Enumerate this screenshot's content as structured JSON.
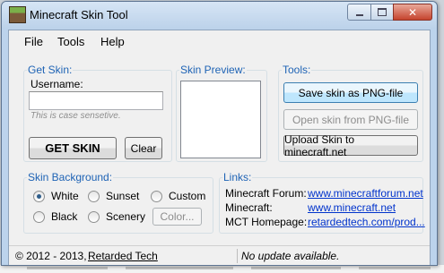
{
  "window": {
    "title": "Minecraft Skin Tool"
  },
  "menu": [
    {
      "label": "File"
    },
    {
      "label": "Tools"
    },
    {
      "label": "Help"
    }
  ],
  "get_skin": {
    "legend": "Get Skin:",
    "username_label": "Username:",
    "username_value": "",
    "hint": "This is case sensetive.",
    "get_button": "GET SKIN",
    "clear_button": "Clear"
  },
  "preview": {
    "legend": "Skin Preview:"
  },
  "tools": {
    "legend": "Tools:",
    "save_button": "Save skin as PNG-file",
    "open_button": "Open skin from PNG-file",
    "upload_button": "Upload Skin to minecraft.net"
  },
  "background": {
    "legend": "Skin Background:",
    "options": [
      {
        "label": "White",
        "selected": true
      },
      {
        "label": "Sunset",
        "selected": false
      },
      {
        "label": "Custom",
        "selected": false
      },
      {
        "label": "Black",
        "selected": false
      },
      {
        "label": "Scenery",
        "selected": false
      }
    ],
    "color_button": "Color..."
  },
  "links": {
    "legend": "Links:",
    "items": [
      {
        "label": "Minecraft Forum:",
        "url": "www.minecraftforum.net"
      },
      {
        "label": "Minecraft:",
        "url": "www.minecraft.net"
      },
      {
        "label": "MCT Homepage:",
        "url": "retardedtech.com/prod..."
      }
    ]
  },
  "status": {
    "copyright": "© 2012 - 2013,",
    "company": "Retarded Tech",
    "update": "No update available."
  },
  "colors": {
    "accent": "#1e63b5",
    "link": "#0033cc",
    "window_frame": "#bcd3ec"
  }
}
